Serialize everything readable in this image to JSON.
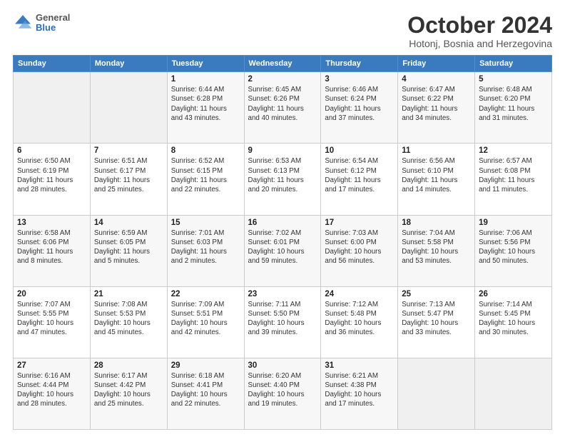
{
  "header": {
    "logo_general": "General",
    "logo_blue": "Blue",
    "title": "October 2024",
    "location": "Hotonj, Bosnia and Herzegovina"
  },
  "weekdays": [
    "Sunday",
    "Monday",
    "Tuesday",
    "Wednesday",
    "Thursday",
    "Friday",
    "Saturday"
  ],
  "weeks": [
    [
      {
        "day": "",
        "empty": true
      },
      {
        "day": "",
        "empty": true
      },
      {
        "day": "1",
        "sunrise": "6:44 AM",
        "sunset": "6:28 PM",
        "daylight": "11 hours and 43 minutes."
      },
      {
        "day": "2",
        "sunrise": "6:45 AM",
        "sunset": "6:26 PM",
        "daylight": "11 hours and 40 minutes."
      },
      {
        "day": "3",
        "sunrise": "6:46 AM",
        "sunset": "6:24 PM",
        "daylight": "11 hours and 37 minutes."
      },
      {
        "day": "4",
        "sunrise": "6:47 AM",
        "sunset": "6:22 PM",
        "daylight": "11 hours and 34 minutes."
      },
      {
        "day": "5",
        "sunrise": "6:48 AM",
        "sunset": "6:20 PM",
        "daylight": "11 hours and 31 minutes."
      }
    ],
    [
      {
        "day": "6",
        "sunrise": "6:50 AM",
        "sunset": "6:19 PM",
        "daylight": "11 hours and 28 minutes."
      },
      {
        "day": "7",
        "sunrise": "6:51 AM",
        "sunset": "6:17 PM",
        "daylight": "11 hours and 25 minutes."
      },
      {
        "day": "8",
        "sunrise": "6:52 AM",
        "sunset": "6:15 PM",
        "daylight": "11 hours and 22 minutes."
      },
      {
        "day": "9",
        "sunrise": "6:53 AM",
        "sunset": "6:13 PM",
        "daylight": "11 hours and 20 minutes."
      },
      {
        "day": "10",
        "sunrise": "6:54 AM",
        "sunset": "6:12 PM",
        "daylight": "11 hours and 17 minutes."
      },
      {
        "day": "11",
        "sunrise": "6:56 AM",
        "sunset": "6:10 PM",
        "daylight": "11 hours and 14 minutes."
      },
      {
        "day": "12",
        "sunrise": "6:57 AM",
        "sunset": "6:08 PM",
        "daylight": "11 hours and 11 minutes."
      }
    ],
    [
      {
        "day": "13",
        "sunrise": "6:58 AM",
        "sunset": "6:06 PM",
        "daylight": "11 hours and 8 minutes."
      },
      {
        "day": "14",
        "sunrise": "6:59 AM",
        "sunset": "6:05 PM",
        "daylight": "11 hours and 5 minutes."
      },
      {
        "day": "15",
        "sunrise": "7:01 AM",
        "sunset": "6:03 PM",
        "daylight": "11 hours and 2 minutes."
      },
      {
        "day": "16",
        "sunrise": "7:02 AM",
        "sunset": "6:01 PM",
        "daylight": "10 hours and 59 minutes."
      },
      {
        "day": "17",
        "sunrise": "7:03 AM",
        "sunset": "6:00 PM",
        "daylight": "10 hours and 56 minutes."
      },
      {
        "day": "18",
        "sunrise": "7:04 AM",
        "sunset": "5:58 PM",
        "daylight": "10 hours and 53 minutes."
      },
      {
        "day": "19",
        "sunrise": "7:06 AM",
        "sunset": "5:56 PM",
        "daylight": "10 hours and 50 minutes."
      }
    ],
    [
      {
        "day": "20",
        "sunrise": "7:07 AM",
        "sunset": "5:55 PM",
        "daylight": "10 hours and 47 minutes."
      },
      {
        "day": "21",
        "sunrise": "7:08 AM",
        "sunset": "5:53 PM",
        "daylight": "10 hours and 45 minutes."
      },
      {
        "day": "22",
        "sunrise": "7:09 AM",
        "sunset": "5:51 PM",
        "daylight": "10 hours and 42 minutes."
      },
      {
        "day": "23",
        "sunrise": "7:11 AM",
        "sunset": "5:50 PM",
        "daylight": "10 hours and 39 minutes."
      },
      {
        "day": "24",
        "sunrise": "7:12 AM",
        "sunset": "5:48 PM",
        "daylight": "10 hours and 36 minutes."
      },
      {
        "day": "25",
        "sunrise": "7:13 AM",
        "sunset": "5:47 PM",
        "daylight": "10 hours and 33 minutes."
      },
      {
        "day": "26",
        "sunrise": "7:14 AM",
        "sunset": "5:45 PM",
        "daylight": "10 hours and 30 minutes."
      }
    ],
    [
      {
        "day": "27",
        "sunrise": "6:16 AM",
        "sunset": "4:44 PM",
        "daylight": "10 hours and 28 minutes."
      },
      {
        "day": "28",
        "sunrise": "6:17 AM",
        "sunset": "4:42 PM",
        "daylight": "10 hours and 25 minutes."
      },
      {
        "day": "29",
        "sunrise": "6:18 AM",
        "sunset": "4:41 PM",
        "daylight": "10 hours and 22 minutes."
      },
      {
        "day": "30",
        "sunrise": "6:20 AM",
        "sunset": "4:40 PM",
        "daylight": "10 hours and 19 minutes."
      },
      {
        "day": "31",
        "sunrise": "6:21 AM",
        "sunset": "4:38 PM",
        "daylight": "10 hours and 17 minutes."
      },
      {
        "day": "",
        "empty": true
      },
      {
        "day": "",
        "empty": true
      }
    ]
  ]
}
